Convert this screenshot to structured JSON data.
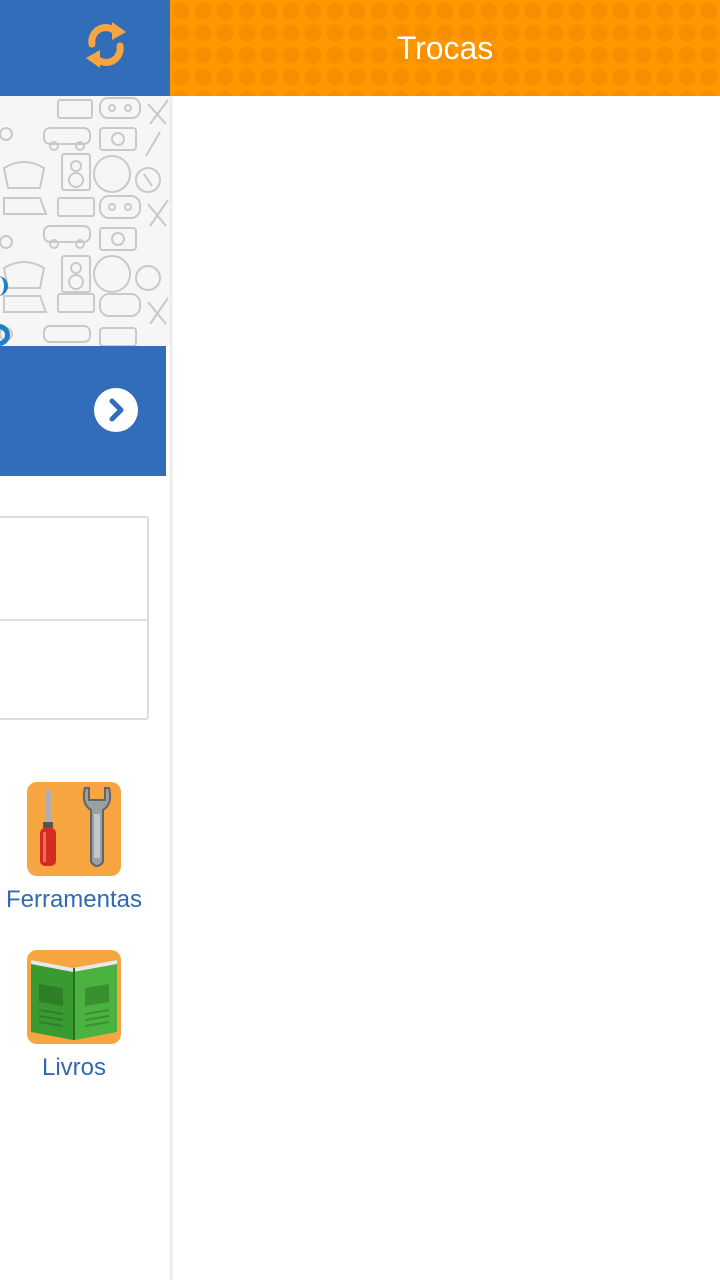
{
  "header": {
    "title": "Trocas"
  },
  "drawer": {
    "refresh_icon": "refresh-icon",
    "login_arrow_icon": "chevron-right-icon",
    "categories": [
      {
        "label": "Ferramentas",
        "icon": "tools-icon"
      },
      {
        "label": "Livros",
        "icon": "book-icon"
      }
    ]
  },
  "colors": {
    "header_orange": "#ff9800",
    "drawer_blue": "#326db9",
    "tile_orange": "#f7a540",
    "link_blue": "#3269b0"
  }
}
